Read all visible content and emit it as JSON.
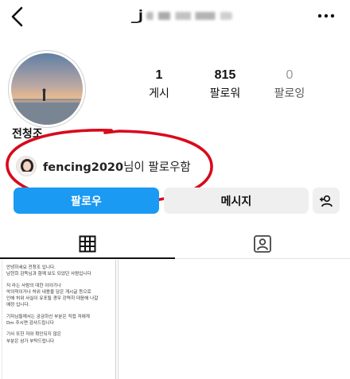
{
  "header": {
    "username_visible": "_j",
    "back_icon": "chevron-left-icon",
    "more_icon": "more-horizontal-icon"
  },
  "profile": {
    "full_name": "전청조",
    "stats": [
      {
        "value": "1",
        "label": "게시"
      },
      {
        "value": "815",
        "label": "팔로워"
      },
      {
        "value": "0",
        "label": "팔로잉"
      }
    ],
    "followed_by": {
      "account": "fencing2020",
      "suffix": "님이 팔로우함"
    }
  },
  "actions": {
    "follow_label": "팔로우",
    "message_label": "메시지",
    "add_icon": "person-add-icon"
  },
  "tabs": [
    {
      "name": "posts",
      "icon": "grid-icon",
      "active": true
    },
    {
      "name": "tagged",
      "icon": "tagged-person-icon",
      "active": false
    }
  ],
  "post": {
    "lines": [
      "안녕하세요 전청조 입니다.",
      "남현희 감독님과 함께 보도 되었던 사람입니다",
      "",
      "저 라는 사람의 대한 이야기나",
      "악의적이거나 허위 내용을 담은 게시글 등으로",
      "인해 허위 사실이 유포될 경우 강력히 대응해 나갈",
      "예정 입니다.",
      "",
      "기자님들께서는 궁금하신 부분은 직접 저에게",
      "Dm 주시면 감사드립니다",
      "",
      "기사 또한 저와 확인되지 않은",
      "부분은 삼가 부탁드립니다"
    ]
  },
  "colors": {
    "follow_button": "#1a9af2",
    "annotation_ellipse": "#d9091b",
    "secondary_button": "#efefef"
  }
}
